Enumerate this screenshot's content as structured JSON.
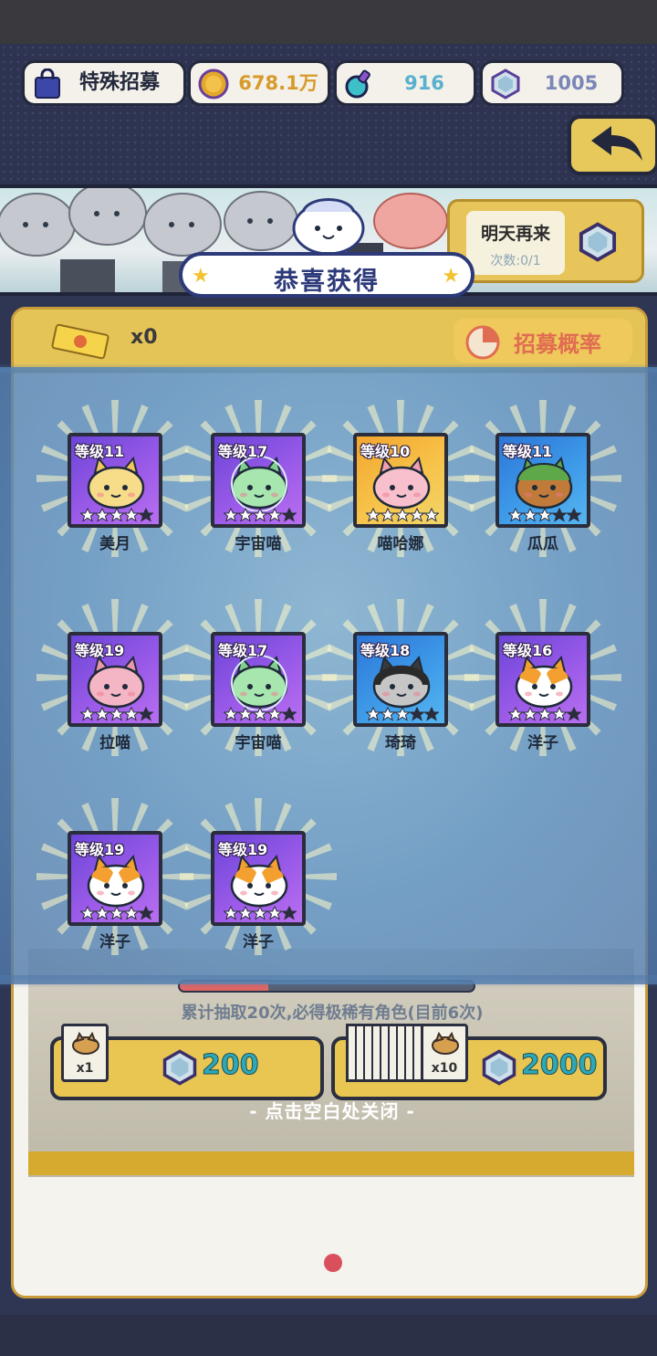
{
  "header": {
    "shop_label": "特殊招募",
    "coins": "678.1万",
    "potion": "916",
    "gems": "1005"
  },
  "side_box": {
    "title": "明天再来",
    "subtitle": "次数:0/1"
  },
  "panel": {
    "ticket_count": "x0",
    "rate_label": "招募概率",
    "progress_note": "累计抽取20次,必得极稀有角色(目前6次)",
    "progress_fraction": 0.3,
    "single_tag": "x1",
    "single_price": "200",
    "multi_tag": "x10",
    "multi_price": "2000"
  },
  "reward": {
    "title": "恭喜获得",
    "close_hint": "- 点击空白处关闭 -",
    "cards": [
      {
        "level": "等级11",
        "name": "美月",
        "rarity": "purple",
        "stars": 4,
        "cat": "cream"
      },
      {
        "level": "等级17",
        "name": "宇宙喵",
        "rarity": "purple",
        "stars": 4,
        "cat": "green"
      },
      {
        "level": "等级10",
        "name": "喵哈娜",
        "rarity": "gold",
        "stars": 5,
        "cat": "pink"
      },
      {
        "level": "等级11",
        "name": "瓜瓜",
        "rarity": "blue",
        "stars": 3,
        "cat": "melon"
      },
      {
        "level": "等级19",
        "name": "拉喵",
        "rarity": "purple",
        "stars": 4,
        "cat": "rose"
      },
      {
        "level": "等级17",
        "name": "宇宙喵",
        "rarity": "purple",
        "stars": 4,
        "cat": "green"
      },
      {
        "level": "等级18",
        "name": "琦琦",
        "rarity": "blue",
        "stars": 3,
        "cat": "gray"
      },
      {
        "level": "等级16",
        "name": "洋子",
        "rarity": "purple",
        "stars": 4,
        "cat": "calico"
      },
      {
        "level": "等级19",
        "name": "洋子",
        "rarity": "purple",
        "stars": 4,
        "cat": "calico"
      },
      {
        "level": "等级19",
        "name": "洋子",
        "rarity": "purple",
        "stars": 4,
        "cat": "calico"
      }
    ]
  },
  "colors": {
    "gold_accent": "#e5c457",
    "title_blue": "#2d3a7a",
    "price_teal": "#2ea8b6"
  }
}
